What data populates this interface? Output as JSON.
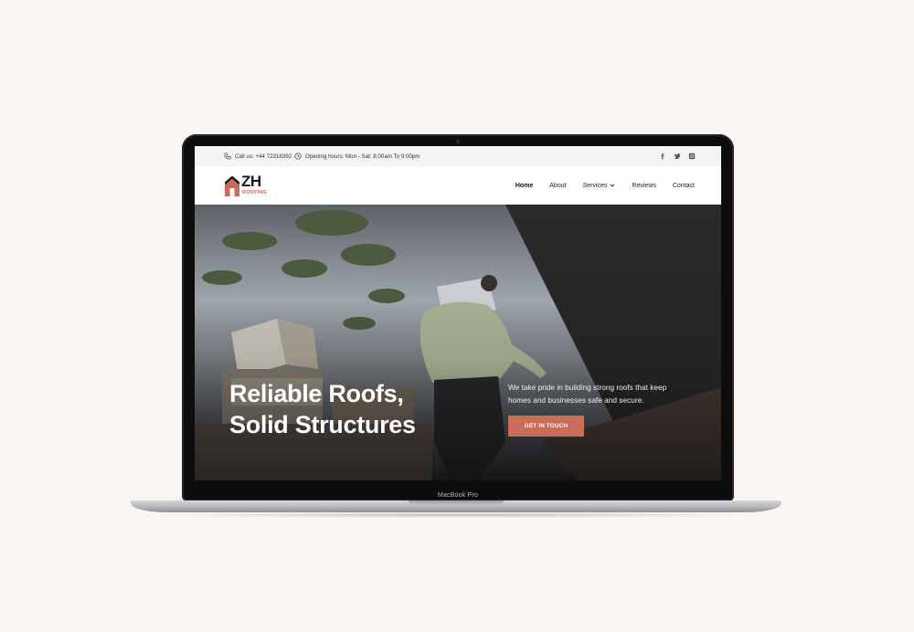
{
  "device": {
    "label": "MacBook Pro"
  },
  "topbar": {
    "phone": "Call us: +44 72318392",
    "hours": "Opening hours: Mon - Sat: 8:00am To 9:00pm",
    "social": [
      "facebook-icon",
      "twitter-icon",
      "instagram-icon"
    ]
  },
  "logo": {
    "mark": "ZH",
    "subtitle": "ROOFING"
  },
  "nav": {
    "items": [
      {
        "label": "Home",
        "active": true
      },
      {
        "label": "About"
      },
      {
        "label": "Services",
        "has_dropdown": true
      },
      {
        "label": "Reviews"
      },
      {
        "label": "Contact"
      }
    ]
  },
  "hero": {
    "title_line1": "Reliable Roofs,",
    "title_line2": "Solid Structures",
    "text": "We take pride in building strong roofs that keep homes and businesses safe and secure.",
    "cta": "GET IN TOUCH"
  },
  "colors": {
    "accent": "#c96c5a",
    "topbar_bg": "#f4f4f4",
    "dark": "#1a1a1a"
  }
}
